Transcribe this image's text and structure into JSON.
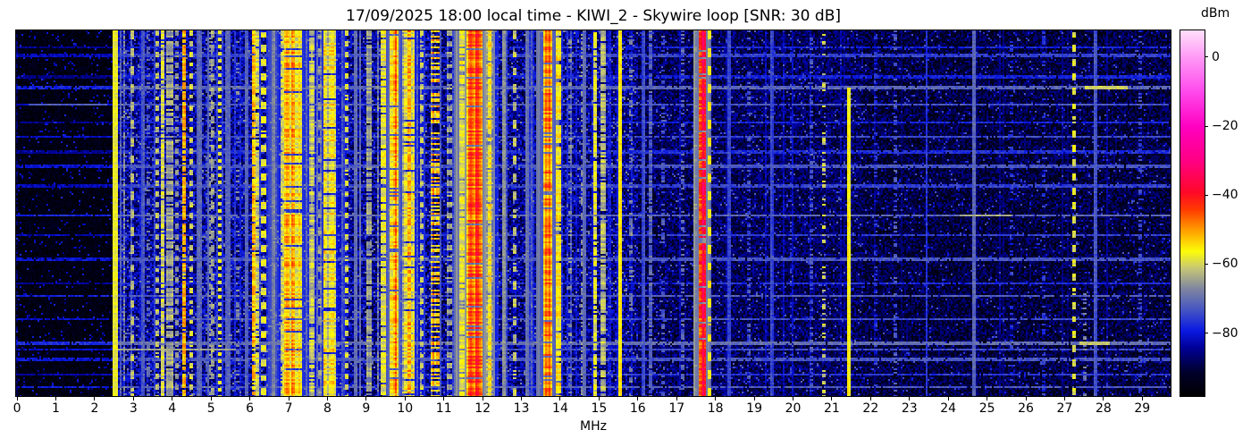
{
  "chart_data": {
    "type": "heatmap",
    "subtype": "radio-spectrum-waterfall",
    "title": "17/09/2025 18:00 local time - KIWI_2 - Skywire loop [SNR: 30 dB]",
    "xlabel": "MHz",
    "ylabel": "",
    "grid": false,
    "legend": false,
    "x_range": [
      0,
      29.73
    ],
    "x_ticks": [
      0,
      1,
      2,
      3,
      4,
      5,
      6,
      7,
      8,
      9,
      10,
      11,
      12,
      13,
      14,
      15,
      16,
      17,
      18,
      19,
      20,
      21,
      22,
      23,
      24,
      25,
      26,
      27,
      28,
      29
    ],
    "x_tick_labels": [
      "0",
      "1",
      "2",
      "3",
      "4",
      "5",
      "6",
      "7",
      "8",
      "9",
      "10",
      "11",
      "12",
      "13",
      "14",
      "15",
      "16",
      "17",
      "18",
      "19",
      "20",
      "21",
      "22",
      "23",
      "24",
      "25",
      "26",
      "27",
      "28",
      "29"
    ],
    "colorbar": {
      "label": "dBm",
      "position": "right",
      "vmin": -98,
      "vmax": 8,
      "tick_values": [
        0,
        -20,
        -40,
        -60,
        -80
      ],
      "tick_labels": [
        "0",
        "−20",
        "−40",
        "−60",
        "−80"
      ]
    },
    "colormap_stops": [
      [
        -98,
        0,
        0,
        0
      ],
      [
        -91,
        0,
        0,
        45
      ],
      [
        -84,
        0,
        0,
        150
      ],
      [
        -79,
        10,
        25,
        225
      ],
      [
        -73,
        70,
        85,
        195
      ],
      [
        -67,
        125,
        132,
        160
      ],
      [
        -61,
        198,
        198,
        118
      ],
      [
        -56,
        252,
        252,
        8
      ],
      [
        -50,
        255,
        158,
        0
      ],
      [
        -44,
        255,
        60,
        0
      ],
      [
        -39,
        255,
        8,
        40
      ],
      [
        -30,
        255,
        0,
        130
      ],
      [
        -20,
        255,
        0,
        192
      ],
      [
        -10,
        255,
        72,
        235
      ],
      [
        0,
        255,
        152,
        246
      ],
      [
        8,
        255,
        224,
        250
      ]
    ],
    "noise_zones": [
      {
        "f0": 0.0,
        "f1": 2.56,
        "base": -95,
        "var": 3,
        "speckle_p": 0.04,
        "speckle_level": -81
      },
      {
        "f0": 2.56,
        "f1": 9.0,
        "base": -84,
        "var": 7,
        "speckle_p": 0.06,
        "speckle_level": -70
      },
      {
        "f0": 9.0,
        "f1": 16.0,
        "base": -85,
        "var": 7,
        "speckle_p": 0.06,
        "speckle_level": -70
      },
      {
        "f0": 16.0,
        "f1": 21.8,
        "base": -88,
        "var": 6,
        "speckle_p": 0.05,
        "speckle_level": -74
      },
      {
        "f0": 21.8,
        "f1": 29.73,
        "base": -90,
        "var": 6,
        "speckle_p": 0.04,
        "speckle_level": -76
      }
    ],
    "texture": {
      "line_p_mid": 0.25,
      "line_p_high": 0.1,
      "line_p_top": 0.05,
      "gray_col_p": 0.03
    },
    "bands": [
      {
        "f": 2.51,
        "w": 0.05,
        "level": -57,
        "style": "solid"
      },
      {
        "f": 2.95,
        "w": 0.04,
        "level": -63,
        "style": "dashed"
      },
      {
        "f": 3.2,
        "w": 0.04,
        "level": -73,
        "style": "solid"
      },
      {
        "f": 3.38,
        "w": 0.04,
        "level": -70,
        "style": "sparse"
      },
      {
        "f": 3.6,
        "w": 0.05,
        "level": -62,
        "style": "dashed"
      },
      {
        "f": 3.74,
        "w": 0.06,
        "level": -59,
        "style": "patchy"
      },
      {
        "f": 3.92,
        "w": 0.12,
        "level": -64,
        "style": "patchy"
      },
      {
        "f": 4.08,
        "w": 0.04,
        "level": -66,
        "style": "dashed"
      },
      {
        "f": 4.27,
        "w": 0.06,
        "level": -50,
        "style": "patchy"
      },
      {
        "f": 4.46,
        "w": 0.04,
        "level": -61,
        "style": "dashed"
      },
      {
        "f": 4.65,
        "w": 0.04,
        "level": -71,
        "style": "solid"
      },
      {
        "f": 4.88,
        "w": 0.04,
        "level": -73,
        "style": "sparse"
      },
      {
        "f": 5.02,
        "w": 0.04,
        "level": -64,
        "style": "dashed"
      },
      {
        "f": 5.22,
        "w": 0.05,
        "level": -58,
        "style": "dashed"
      },
      {
        "f": 5.45,
        "w": 0.04,
        "level": -71,
        "style": "solid"
      },
      {
        "f": 5.65,
        "w": 0.04,
        "level": -69,
        "style": "sparse"
      },
      {
        "f": 5.88,
        "w": 0.04,
        "level": -72,
        "style": "solid"
      },
      {
        "f": 6.07,
        "w": 0.05,
        "level": -52,
        "style": "patchy"
      },
      {
        "f": 6.19,
        "w": 0.04,
        "level": -60,
        "style": "patchy"
      },
      {
        "f": 6.33,
        "w": 0.05,
        "level": -58,
        "style": "dashed"
      },
      {
        "f": 6.57,
        "w": 0.04,
        "level": -67,
        "style": "solid"
      },
      {
        "f": 6.8,
        "w": 0.06,
        "level": -60,
        "style": "patchy"
      },
      {
        "f": 7.08,
        "w": 0.45,
        "level": -53,
        "style": "broadcast"
      },
      {
        "f": 7.58,
        "w": 0.1,
        "level": -61,
        "style": "patchy"
      },
      {
        "f": 7.8,
        "w": 0.05,
        "level": -66,
        "style": "dashed"
      },
      {
        "f": 8.05,
        "w": 0.28,
        "level": -55,
        "style": "broadcast"
      },
      {
        "f": 8.47,
        "w": 0.06,
        "level": -60,
        "style": "dashed"
      },
      {
        "f": 8.72,
        "w": 0.04,
        "level": -69,
        "style": "solid"
      },
      {
        "f": 9.05,
        "w": 0.06,
        "level": -65,
        "style": "patchy"
      },
      {
        "f": 9.42,
        "w": 0.1,
        "level": -58,
        "style": "patchy"
      },
      {
        "f": 9.68,
        "w": 0.2,
        "level": -49,
        "style": "broadcast"
      },
      {
        "f": 10.05,
        "w": 0.28,
        "level": -55,
        "style": "broadcast"
      },
      {
        "f": 10.42,
        "w": 0.05,
        "level": -62,
        "style": "dashed"
      },
      {
        "f": 10.74,
        "w": 0.2,
        "level": -53,
        "style": "dotted"
      },
      {
        "f": 11.12,
        "w": 0.05,
        "level": -64,
        "style": "dashed"
      },
      {
        "f": 11.45,
        "w": 0.06,
        "level": -58,
        "style": "patchy"
      },
      {
        "f": 11.76,
        "w": 0.36,
        "level": -43,
        "style": "broadcast"
      },
      {
        "f": 12.15,
        "w": 0.16,
        "level": -55,
        "style": "broadcast"
      },
      {
        "f": 12.52,
        "w": 0.04,
        "level": -67,
        "style": "solid"
      },
      {
        "f": 12.82,
        "w": 0.05,
        "level": -61,
        "style": "dashed"
      },
      {
        "f": 13.12,
        "w": 0.04,
        "level": -69,
        "style": "solid"
      },
      {
        "f": 13.66,
        "w": 0.18,
        "level": -46,
        "style": "broadcast"
      },
      {
        "f": 13.93,
        "w": 0.07,
        "level": -56,
        "style": "patchy"
      },
      {
        "f": 14.22,
        "w": 0.05,
        "level": -67,
        "style": "sparse"
      },
      {
        "f": 14.58,
        "w": 0.04,
        "level": -71,
        "style": "solid"
      },
      {
        "f": 14.88,
        "w": 0.08,
        "level": -58,
        "style": "patchy"
      },
      {
        "f": 15.08,
        "w": 0.07,
        "level": -62,
        "style": "patchy"
      },
      {
        "f": 15.5,
        "w": 0.05,
        "level": -55,
        "style": "solid"
      },
      {
        "f": 15.78,
        "w": 0.04,
        "level": -68,
        "style": "sparse"
      },
      {
        "f": 16.1,
        "w": 0.04,
        "level": -74,
        "style": "solid"
      },
      {
        "f": 16.3,
        "w": 0.05,
        "level": -71,
        "style": "patchy"
      },
      {
        "f": 16.62,
        "w": 0.04,
        "level": -74,
        "style": "sparse"
      },
      {
        "f": 17.12,
        "w": 0.04,
        "level": -72,
        "style": "sparse"
      },
      {
        "f": 17.45,
        "w": 0.04,
        "level": -66,
        "style": "dashed"
      },
      {
        "f": 17.63,
        "w": 0.15,
        "level": -38,
        "style": "broadcast"
      },
      {
        "f": 17.82,
        "w": 0.05,
        "level": -57,
        "style": "dashed"
      },
      {
        "f": 18.35,
        "w": 0.04,
        "level": -75,
        "style": "solid"
      },
      {
        "f": 18.85,
        "w": 0.04,
        "level": -73,
        "style": "sparse"
      },
      {
        "f": 19.42,
        "w": 0.04,
        "level": -75,
        "style": "solid"
      },
      {
        "f": 19.92,
        "w": 0.04,
        "level": -74,
        "style": "sparse"
      },
      {
        "f": 20.45,
        "w": 0.04,
        "level": -73,
        "style": "sparse"
      },
      {
        "f": 20.76,
        "w": 0.05,
        "level": -61,
        "style": "sparse"
      },
      {
        "f": 21.4,
        "w": 0.05,
        "level": -56,
        "style": "solid",
        "t0": 0.155
      },
      {
        "f": 22.12,
        "w": 0.04,
        "level": -76,
        "style": "sparse"
      },
      {
        "f": 22.62,
        "w": 0.04,
        "level": -74,
        "style": "sparse"
      },
      {
        "f": 23.42,
        "w": 0.04,
        "level": -76,
        "style": "solid"
      },
      {
        "f": 24.65,
        "w": 0.05,
        "level": -71,
        "style": "solid"
      },
      {
        "f": 25.62,
        "w": 0.04,
        "level": -77,
        "style": "sparse"
      },
      {
        "f": 26.42,
        "w": 0.04,
        "level": -76,
        "style": "sparse"
      },
      {
        "f": 27.2,
        "w": 0.05,
        "level": -59,
        "style": "dashed"
      },
      {
        "f": 27.5,
        "w": 0.08,
        "level": -68,
        "style": "sparse",
        "t0": 0.72
      },
      {
        "f": 27.76,
        "w": 0.04,
        "level": -73,
        "style": "solid"
      },
      {
        "f": 28.92,
        "w": 0.04,
        "level": -75,
        "style": "sparse"
      }
    ],
    "time_streaks": [
      {
        "t": 0.045,
        "level": -78
      },
      {
        "t": 0.066,
        "level": -75
      },
      {
        "t": 0.125,
        "level": -78
      },
      {
        "t": 0.155,
        "level": -71,
        "seg": [
          27.5,
          28.6,
          -60
        ]
      },
      {
        "t": 0.2,
        "level": -73,
        "seg": [
          0.3,
          2.3,
          -72
        ]
      },
      {
        "t": 0.25,
        "level": -78
      },
      {
        "t": 0.29,
        "level": -74
      },
      {
        "t": 0.33,
        "level": -77
      },
      {
        "t": 0.37,
        "level": -73
      },
      {
        "t": 0.425,
        "level": -75
      },
      {
        "t": 0.505,
        "level": -71,
        "seg": [
          24.3,
          25.6,
          -63
        ]
      },
      {
        "t": 0.56,
        "level": -75
      },
      {
        "t": 0.625,
        "level": -73
      },
      {
        "t": 0.69,
        "level": -77
      },
      {
        "t": 0.725,
        "level": -72
      },
      {
        "t": 0.79,
        "level": -74
      },
      {
        "t": 0.855,
        "level": -70,
        "seg": [
          27.4,
          28.1,
          -61
        ]
      },
      {
        "t": 0.873,
        "level": -74,
        "seg": [
          2.6,
          5.6,
          -64
        ]
      },
      {
        "t": 0.9,
        "level": -73
      },
      {
        "t": 0.94,
        "level": -76
      },
      {
        "t": 0.975,
        "level": -72
      }
    ],
    "render": {
      "seed": 917,
      "cols": 646,
      "rows": 205
    }
  }
}
